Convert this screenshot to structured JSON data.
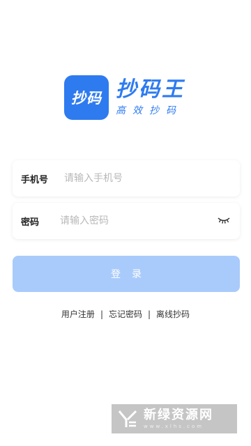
{
  "brand": {
    "tile_text": "抄码",
    "name": "抄码王",
    "slogan": "高效抄码",
    "color": "#2e7bf0"
  },
  "form": {
    "phone": {
      "label": "手机号",
      "placeholder": "请输入手机号",
      "value": ""
    },
    "password": {
      "label": "密码",
      "placeholder": "请输入密码",
      "value": "",
      "toggle_icon": "eye-closed-icon"
    }
  },
  "login_button": {
    "label": "登录",
    "color": "#a9cbfb"
  },
  "links": {
    "register": "用户注册",
    "forgot": "忘记密码",
    "offline": "离线抄码",
    "separator": "|"
  },
  "watermark": {
    "title": "新绿资源网",
    "url": "www.xlhs.com"
  }
}
